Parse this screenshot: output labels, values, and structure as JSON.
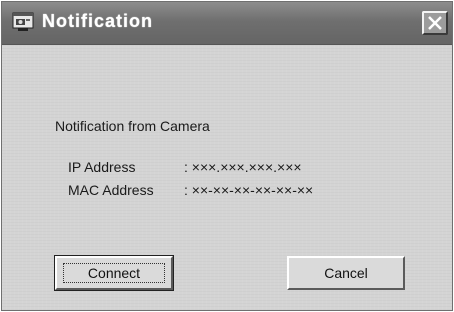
{
  "window": {
    "title": "Notification",
    "icon": "camera-notification-icon",
    "close_icon": "close-icon"
  },
  "dialog": {
    "message": "Notification from Camera",
    "ip": {
      "label": "IP Address",
      "separator": ":",
      "value": "×××.×××.×××.×××"
    },
    "mac": {
      "label": "MAC Address",
      "separator": ":",
      "value": "××-××-××-××-××-××"
    }
  },
  "buttons": {
    "connect": "Connect",
    "cancel": "Cancel"
  }
}
